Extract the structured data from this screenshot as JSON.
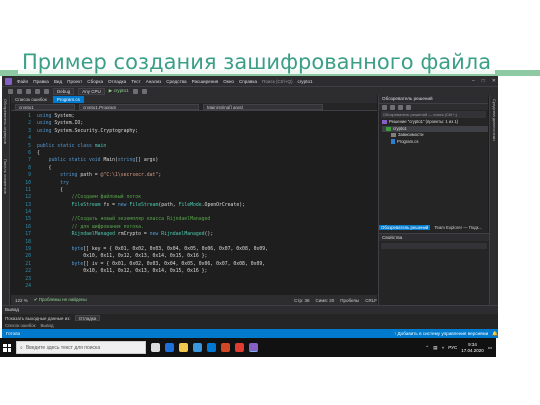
{
  "slide": {
    "title": "Пример создания зашифрованного файла"
  },
  "vs": {
    "menu": [
      "Файл",
      "Правка",
      "Вид",
      "Проект",
      "Сборка",
      "Отладка",
      "Тест",
      "Анализ",
      "Средства",
      "Расширения",
      "Окно",
      "Справка",
      "Поиск (Ctrl+Q)",
      "crypto1"
    ],
    "toolbar": {
      "config": "Debug",
      "platform": "Any CPU",
      "start": "crypto1"
    },
    "left_rail": [
      "Обозреватель серверов",
      "Панель элементов"
    ],
    "tabs": [
      "Список ошибок",
      "Program.cs"
    ],
    "navbar": [
      "crypto1",
      "crypto1.Program",
      "Main(string[] args)"
    ],
    "code": [
      {
        "n": "1",
        "parts": [
          [
            "kw",
            "using "
          ],
          [
            "id",
            "System;"
          ]
        ]
      },
      {
        "n": "2",
        "parts": [
          [
            "kw",
            "using "
          ],
          [
            "id",
            "System.IO;"
          ]
        ]
      },
      {
        "n": "3",
        "parts": [
          [
            "kw",
            "using "
          ],
          [
            "id",
            "System.Security.Cryptography;"
          ]
        ]
      },
      {
        "n": "4",
        "parts": []
      },
      {
        "n": "5",
        "parts": [
          [
            "kw",
            "public static class "
          ],
          [
            "ty",
            "main"
          ]
        ]
      },
      {
        "n": "6",
        "parts": [
          [
            "id",
            "{"
          ]
        ]
      },
      {
        "n": "7",
        "parts": [
          [
            "id",
            "    "
          ],
          [
            "kw",
            "public static void "
          ],
          [
            "id",
            "Main("
          ],
          [
            "kw",
            "string"
          ],
          [
            "id",
            "[] args)"
          ]
        ]
      },
      {
        "n": "8",
        "parts": [
          [
            "id",
            "    {"
          ]
        ]
      },
      {
        "n": "9",
        "parts": [
          [
            "id",
            "        "
          ],
          [
            "kw",
            "string "
          ],
          [
            "id",
            "path = "
          ],
          [
            "st",
            "@\"C:\\1\\secrsecr.dat\""
          ],
          [
            "id",
            ";"
          ]
        ]
      },
      {
        "n": "10",
        "parts": [
          [
            "id",
            "        "
          ],
          [
            "kw",
            "try"
          ]
        ]
      },
      {
        "n": "11",
        "parts": [
          [
            "id",
            "        {"
          ]
        ]
      },
      {
        "n": "12",
        "parts": [
          [
            "id",
            "            "
          ],
          [
            "cm",
            "//Создаем файловый поток"
          ]
        ]
      },
      {
        "n": "13",
        "parts": [
          [
            "id",
            "            "
          ],
          [
            "ty",
            "FileStream "
          ],
          [
            "id",
            "fs = "
          ],
          [
            "kw",
            "new "
          ],
          [
            "ty",
            "FileStream"
          ],
          [
            "id",
            "(path, "
          ],
          [
            "ty",
            "FileMode"
          ],
          [
            "id",
            ".OpenOrCreate);"
          ]
        ]
      },
      {
        "n": "14",
        "parts": []
      },
      {
        "n": "15",
        "parts": [
          [
            "id",
            "            "
          ],
          [
            "cm",
            "//Создать новый экземпляр класса RijndaelManaged"
          ]
        ]
      },
      {
        "n": "16",
        "parts": [
          [
            "id",
            "            "
          ],
          [
            "cm",
            "// для шифрования потока."
          ]
        ]
      },
      {
        "n": "17",
        "parts": [
          [
            "id",
            "            "
          ],
          [
            "ty",
            "RijndaelManaged "
          ],
          [
            "id",
            "rmCrypto = "
          ],
          [
            "kw",
            "new "
          ],
          [
            "ty",
            "RijndaelManaged"
          ],
          [
            "id",
            "();"
          ]
        ]
      },
      {
        "n": "18",
        "parts": []
      },
      {
        "n": "19",
        "parts": [
          [
            "id",
            "            "
          ],
          [
            "kw",
            "byte"
          ],
          [
            "id",
            "[] key = { 0x01, 0x02, 0x03, 0x04, 0x05, 0x06, 0x07, 0x08, 0x09,"
          ]
        ]
      },
      {
        "n": "20",
        "parts": [
          [
            "id",
            "                0x10, 0x11, 0x12, 0x13, 0x14, 0x15, 0x16 };"
          ]
        ]
      },
      {
        "n": "21",
        "parts": [
          [
            "id",
            "            "
          ],
          [
            "kw",
            "byte"
          ],
          [
            "id",
            "[] iv = { 0x01, 0x02, 0x03, 0x04, 0x05, 0x06, 0x07, 0x08, 0x09,"
          ]
        ]
      },
      {
        "n": "22",
        "parts": [
          [
            "id",
            "                0x10, 0x11, 0x12, 0x13, 0x14, 0x15, 0x16 };"
          ]
        ]
      },
      {
        "n": "23",
        "parts": []
      },
      {
        "n": "24",
        "parts": []
      }
    ],
    "editor_status": {
      "zoom": "122 %",
      "issues": "Проблемы не найдены",
      "pos": "Стр: 36",
      "col": "Симв: 20",
      "spaces": "Пробелы",
      "eol": "CRLF"
    },
    "solution_explorer": {
      "title": "Обозреватель решений",
      "search": "Обозреватель решений — поиск (Ctrl+;)",
      "items": [
        "Решение \"crypto1\" (проекты: 1 из 1)",
        "crypto1",
        "Зависимости",
        "Program.cs"
      ]
    },
    "right_tabs": [
      "Обозреватель решений",
      "Team Explorer — Подк..."
    ],
    "properties_title": "Свойства",
    "right_rail": "Средства диагностики",
    "output": {
      "title": "Вывод",
      "show_from": "Показать выходные данные из:",
      "source": "Отладка",
      "tabs": [
        "Список ошибок",
        "Вывод"
      ]
    },
    "statusbar": {
      "ready": "Готово",
      "vcs": "Добавить в систему управления версиями"
    }
  },
  "taskbar": {
    "search": "Введите здесь текст для поиска",
    "lang": "РУС",
    "time": "9:34",
    "date": "17.04.2020"
  }
}
